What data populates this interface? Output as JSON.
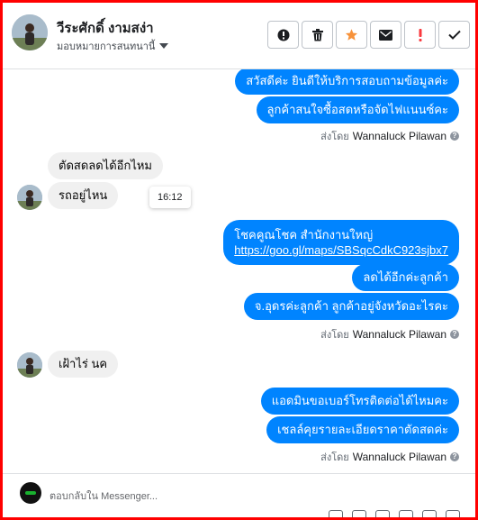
{
  "header": {
    "contact_name": "วีระศักดิ์ งามสง่า",
    "assign_label": "มอบหมายการสนทนานี้",
    "actions": [
      "spam-icon",
      "trash-icon",
      "star-icon",
      "envelope-icon",
      "alert-icon",
      "check-icon"
    ],
    "colors": {
      "star": "#f7923a",
      "alert": "#fa383e"
    }
  },
  "chat": {
    "out_1": "สวัสดีค่ะ  ยินดีให้บริการสอบถามข้อมูลค่ะ",
    "out_2": "ลูกค้าสนใจซื้อสดหรือจัดไฟแนนซ์คะ",
    "sent_by_prefix": "ส่งโดย",
    "sender": "Wannaluck Pilawan",
    "in_1": "ตัดสดลดได้อีกไหม",
    "in_2": "รถอยู่ไหน",
    "tooltip_time": "16:12",
    "out_3_line1": "โชคคูณโชค สำนักงานใหญ่",
    "out_3_link": "https://goo.gl/maps/SBSqcCdkC923sjbx7",
    "out_4": "ลดได้อีกค่ะลูกค้า",
    "out_5": "จ.อุดรค่ะลูกค้า  ลูกค้าอยู่จังหวัดอะไรคะ",
    "in_3": "เฝ้าไร่ นค",
    "out_6": "แอดมินขอเบอร์โทรติดต่อได้ไหมคะ",
    "out_7": "เชลล์คุยรายละเอียดราคาตัดสดค่ะ",
    "bubble_color": "#0084ff"
  },
  "composer": {
    "placeholder": "ตอบกลับใน Messenger..."
  }
}
